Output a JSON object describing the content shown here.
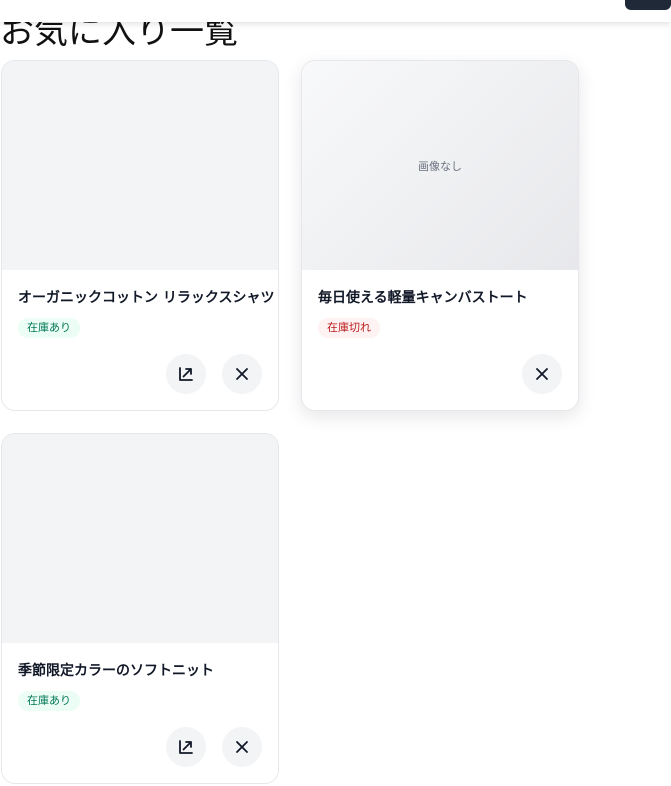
{
  "page": {
    "title": "お気に入り一覧"
  },
  "colors": {
    "in_stock_bg": "#ecfdf5",
    "in_stock_text": "#047857",
    "out_of_stock_bg": "#fef2f2",
    "out_of_stock_text": "#b91c1c",
    "icon_button_bg": "#f3f4f6"
  },
  "favorites": [
    {
      "name": "オーガニックコットン リラックスシャツ",
      "stock_label": "在庫あり",
      "stock_status": "in",
      "image_text": "",
      "actions": [
        "open-icon",
        "close-icon"
      ]
    },
    {
      "name": "毎日使える軽量キャンバストート",
      "stock_label": "在庫切れ",
      "stock_status": "out",
      "image_text": "画像なし",
      "actions": [
        "close-icon"
      ]
    },
    {
      "name": "季節限定カラーのソフトニット",
      "stock_label": "在庫あり",
      "stock_status": "in",
      "image_text": "",
      "actions": [
        "open-icon",
        "close-icon"
      ]
    }
  ]
}
